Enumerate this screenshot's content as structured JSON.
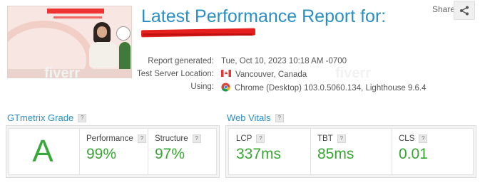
{
  "header": {
    "title": "Latest Performance Report for:",
    "share_label": "Share"
  },
  "report": {
    "generated_label": "Report generated:",
    "generated_value": "Tue, Oct 10, 2023 10:18 AM -0700",
    "location_label": "Test Server Location:",
    "location_value": "Vancouver, Canada",
    "using_label": "Using:",
    "using_value": "Chrome (Desktop) 103.0.5060.134, Lighthouse 9.6.4"
  },
  "grade": {
    "section_title": "GTmetrix Grade",
    "letter": "A",
    "performance_label": "Performance",
    "performance_value": "99%",
    "structure_label": "Structure",
    "structure_value": "97%"
  },
  "vitals": {
    "section_title": "Web Vitals",
    "lcp_label": "LCP",
    "lcp_value": "337ms",
    "tbt_label": "TBT",
    "tbt_value": "85ms",
    "cls_label": "CLS",
    "cls_value": "0.01"
  },
  "help_icon_text": "?",
  "colors": {
    "accent": "#2a8fc6",
    "good": "#38a533",
    "redaction": "#e51e1e"
  },
  "icons": {
    "flag": "canada-flag-icon",
    "browser": "chrome-icon",
    "share": "share-icon",
    "help": "help-icon"
  }
}
